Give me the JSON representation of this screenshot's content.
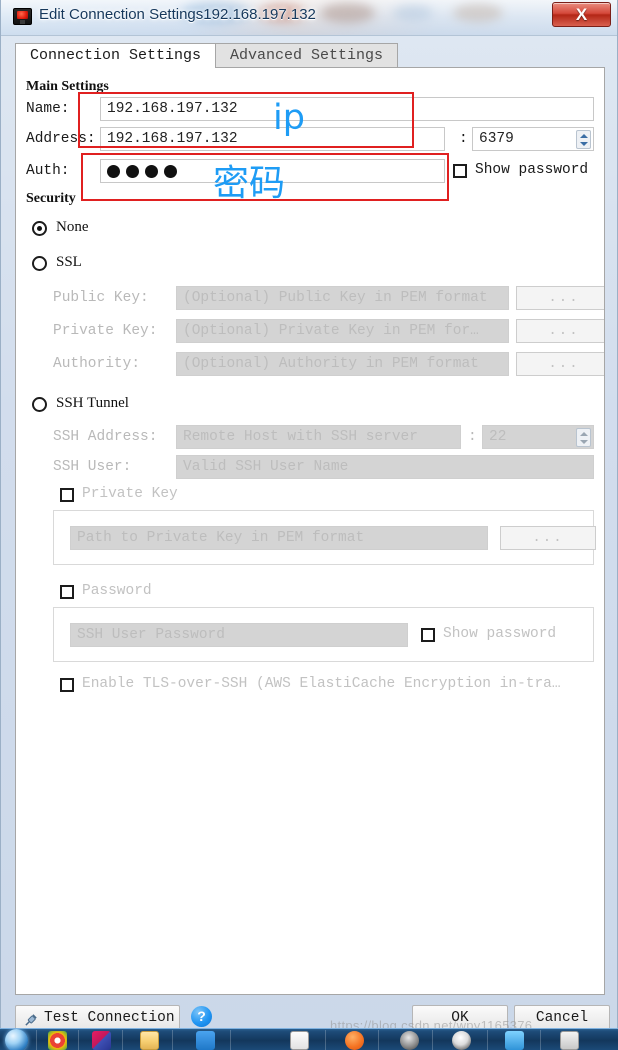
{
  "window": {
    "title": "Edit Connection Settings192.168.197.132",
    "app_icon": "monitor-icon",
    "close_label": "X"
  },
  "tabs": [
    {
      "label": "Connection Settings",
      "active": true
    },
    {
      "label": "Advanced Settings",
      "active": false
    }
  ],
  "main_settings": {
    "group_label": "Main Settings",
    "name_label": "Name:",
    "name_value": "192.168.197.132",
    "address_label": "Address:",
    "address_value": "192.168.197.132",
    "port_separator": ":",
    "port_value": "6379",
    "auth_label": "Auth:",
    "auth_masked_chars": 4,
    "show_password_label": "Show password",
    "show_password_checked": false
  },
  "security": {
    "group_label": "Security",
    "options": [
      {
        "label": "None",
        "selected": true
      },
      {
        "label": "SSL",
        "selected": false
      },
      {
        "label": "SSH Tunnel",
        "selected": false
      }
    ],
    "ssl": {
      "public_key_label": "Public Key:",
      "public_key_placeholder": "(Optional) Public Key in PEM format",
      "private_key_label": "Private Key:",
      "private_key_placeholder": "(Optional) Private Key in PEM for…",
      "authority_label": "Authority:",
      "authority_placeholder": "(Optional) Authority in PEM format",
      "browse_label": "..."
    },
    "ssh": {
      "address_label": "SSH Address:",
      "address_placeholder": "Remote Host with SSH server",
      "port_separator": ":",
      "port_value": "22",
      "user_label": "SSH User:",
      "user_placeholder": "Valid SSH User Name",
      "private_key_checkbox": "Private Key",
      "private_key_checked": false,
      "private_key_placeholder": "Path to Private Key in PEM format",
      "private_key_browse_label": "...",
      "password_checkbox": "Password",
      "password_checked": false,
      "password_placeholder": "SSH User Password",
      "show_password_label": "Show password",
      "show_password_checked": false,
      "tls_checkbox": "Enable TLS-over-SSH (AWS ElastiCache Encryption in-tra…",
      "tls_checked": false
    }
  },
  "annotations": [
    {
      "text": "ip",
      "color": "#1e9cf5"
    },
    {
      "text": "密码",
      "color": "#1e9cf5"
    }
  ],
  "footer": {
    "test_connection_label": "Test Connection",
    "help_label": "?",
    "ok_label": "OK",
    "cancel_label": "Cancel"
  },
  "watermark": "https://blog.csdn.net/wpy1165376...",
  "colors": {
    "accent_red": "#e02020",
    "annotation_blue": "#1e9cf5",
    "title_text": "#16385c",
    "close_button": "#b32616"
  }
}
